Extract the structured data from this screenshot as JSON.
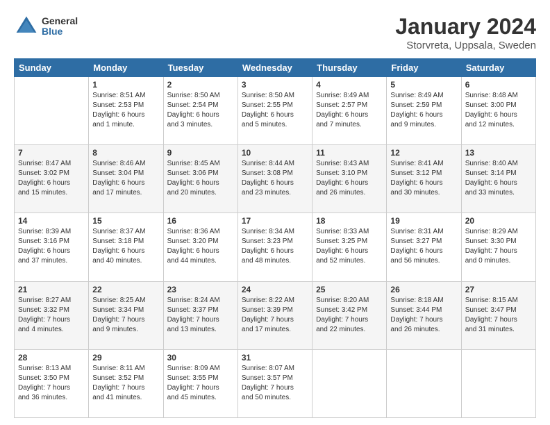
{
  "header": {
    "logo_line1": "General",
    "logo_line2": "Blue",
    "title": "January 2024",
    "subtitle": "Storvreta, Uppsala, Sweden"
  },
  "days_of_week": [
    "Sunday",
    "Monday",
    "Tuesday",
    "Wednesday",
    "Thursday",
    "Friday",
    "Saturday"
  ],
  "weeks": [
    [
      {
        "day": "",
        "lines": []
      },
      {
        "day": "1",
        "lines": [
          "Sunrise: 8:51 AM",
          "Sunset: 2:53 PM",
          "Daylight: 6 hours",
          "and 1 minute."
        ]
      },
      {
        "day": "2",
        "lines": [
          "Sunrise: 8:50 AM",
          "Sunset: 2:54 PM",
          "Daylight: 6 hours",
          "and 3 minutes."
        ]
      },
      {
        "day": "3",
        "lines": [
          "Sunrise: 8:50 AM",
          "Sunset: 2:55 PM",
          "Daylight: 6 hours",
          "and 5 minutes."
        ]
      },
      {
        "day": "4",
        "lines": [
          "Sunrise: 8:49 AM",
          "Sunset: 2:57 PM",
          "Daylight: 6 hours",
          "and 7 minutes."
        ]
      },
      {
        "day": "5",
        "lines": [
          "Sunrise: 8:49 AM",
          "Sunset: 2:59 PM",
          "Daylight: 6 hours",
          "and 9 minutes."
        ]
      },
      {
        "day": "6",
        "lines": [
          "Sunrise: 8:48 AM",
          "Sunset: 3:00 PM",
          "Daylight: 6 hours",
          "and 12 minutes."
        ]
      }
    ],
    [
      {
        "day": "7",
        "lines": [
          "Sunrise: 8:47 AM",
          "Sunset: 3:02 PM",
          "Daylight: 6 hours",
          "and 15 minutes."
        ]
      },
      {
        "day": "8",
        "lines": [
          "Sunrise: 8:46 AM",
          "Sunset: 3:04 PM",
          "Daylight: 6 hours",
          "and 17 minutes."
        ]
      },
      {
        "day": "9",
        "lines": [
          "Sunrise: 8:45 AM",
          "Sunset: 3:06 PM",
          "Daylight: 6 hours",
          "and 20 minutes."
        ]
      },
      {
        "day": "10",
        "lines": [
          "Sunrise: 8:44 AM",
          "Sunset: 3:08 PM",
          "Daylight: 6 hours",
          "and 23 minutes."
        ]
      },
      {
        "day": "11",
        "lines": [
          "Sunrise: 8:43 AM",
          "Sunset: 3:10 PM",
          "Daylight: 6 hours",
          "and 26 minutes."
        ]
      },
      {
        "day": "12",
        "lines": [
          "Sunrise: 8:41 AM",
          "Sunset: 3:12 PM",
          "Daylight: 6 hours",
          "and 30 minutes."
        ]
      },
      {
        "day": "13",
        "lines": [
          "Sunrise: 8:40 AM",
          "Sunset: 3:14 PM",
          "Daylight: 6 hours",
          "and 33 minutes."
        ]
      }
    ],
    [
      {
        "day": "14",
        "lines": [
          "Sunrise: 8:39 AM",
          "Sunset: 3:16 PM",
          "Daylight: 6 hours",
          "and 37 minutes."
        ]
      },
      {
        "day": "15",
        "lines": [
          "Sunrise: 8:37 AM",
          "Sunset: 3:18 PM",
          "Daylight: 6 hours",
          "and 40 minutes."
        ]
      },
      {
        "day": "16",
        "lines": [
          "Sunrise: 8:36 AM",
          "Sunset: 3:20 PM",
          "Daylight: 6 hours",
          "and 44 minutes."
        ]
      },
      {
        "day": "17",
        "lines": [
          "Sunrise: 8:34 AM",
          "Sunset: 3:23 PM",
          "Daylight: 6 hours",
          "and 48 minutes."
        ]
      },
      {
        "day": "18",
        "lines": [
          "Sunrise: 8:33 AM",
          "Sunset: 3:25 PM",
          "Daylight: 6 hours",
          "and 52 minutes."
        ]
      },
      {
        "day": "19",
        "lines": [
          "Sunrise: 8:31 AM",
          "Sunset: 3:27 PM",
          "Daylight: 6 hours",
          "and 56 minutes."
        ]
      },
      {
        "day": "20",
        "lines": [
          "Sunrise: 8:29 AM",
          "Sunset: 3:30 PM",
          "Daylight: 7 hours",
          "and 0 minutes."
        ]
      }
    ],
    [
      {
        "day": "21",
        "lines": [
          "Sunrise: 8:27 AM",
          "Sunset: 3:32 PM",
          "Daylight: 7 hours",
          "and 4 minutes."
        ]
      },
      {
        "day": "22",
        "lines": [
          "Sunrise: 8:25 AM",
          "Sunset: 3:34 PM",
          "Daylight: 7 hours",
          "and 9 minutes."
        ]
      },
      {
        "day": "23",
        "lines": [
          "Sunrise: 8:24 AM",
          "Sunset: 3:37 PM",
          "Daylight: 7 hours",
          "and 13 minutes."
        ]
      },
      {
        "day": "24",
        "lines": [
          "Sunrise: 8:22 AM",
          "Sunset: 3:39 PM",
          "Daylight: 7 hours",
          "and 17 minutes."
        ]
      },
      {
        "day": "25",
        "lines": [
          "Sunrise: 8:20 AM",
          "Sunset: 3:42 PM",
          "Daylight: 7 hours",
          "and 22 minutes."
        ]
      },
      {
        "day": "26",
        "lines": [
          "Sunrise: 8:18 AM",
          "Sunset: 3:44 PM",
          "Daylight: 7 hours",
          "and 26 minutes."
        ]
      },
      {
        "day": "27",
        "lines": [
          "Sunrise: 8:15 AM",
          "Sunset: 3:47 PM",
          "Daylight: 7 hours",
          "and 31 minutes."
        ]
      }
    ],
    [
      {
        "day": "28",
        "lines": [
          "Sunrise: 8:13 AM",
          "Sunset: 3:50 PM",
          "Daylight: 7 hours",
          "and 36 minutes."
        ]
      },
      {
        "day": "29",
        "lines": [
          "Sunrise: 8:11 AM",
          "Sunset: 3:52 PM",
          "Daylight: 7 hours",
          "and 41 minutes."
        ]
      },
      {
        "day": "30",
        "lines": [
          "Sunrise: 8:09 AM",
          "Sunset: 3:55 PM",
          "Daylight: 7 hours",
          "and 45 minutes."
        ]
      },
      {
        "day": "31",
        "lines": [
          "Sunrise: 8:07 AM",
          "Sunset: 3:57 PM",
          "Daylight: 7 hours",
          "and 50 minutes."
        ]
      },
      {
        "day": "",
        "lines": []
      },
      {
        "day": "",
        "lines": []
      },
      {
        "day": "",
        "lines": []
      }
    ]
  ]
}
